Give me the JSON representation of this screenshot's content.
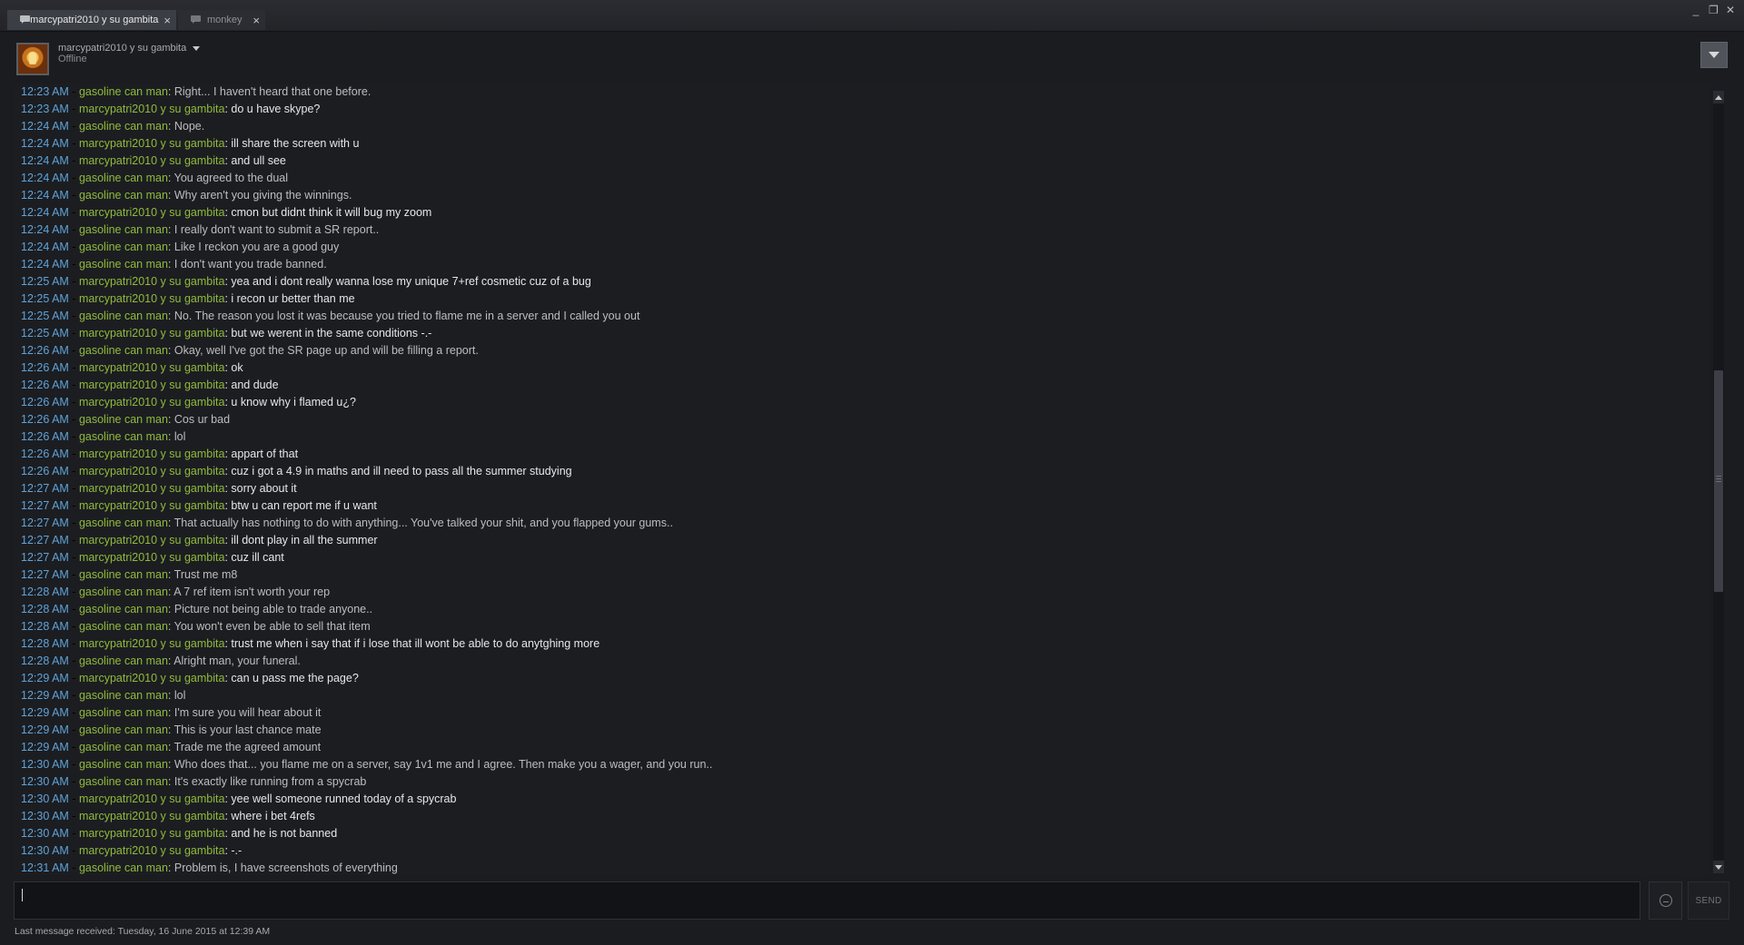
{
  "tabs": [
    {
      "label": "marcypatri2010 y su gambita",
      "close": "×",
      "active": true
    },
    {
      "label": "monkey",
      "close": "×",
      "active": false
    }
  ],
  "window_controls": {
    "minimize": "_",
    "restore": "❐",
    "close": "✕"
  },
  "header": {
    "friend_name": "marcypatri2010 y su gambita",
    "status": "Offline"
  },
  "colors": {
    "timestamp": "#5ea3d9",
    "name": "#90ba3c",
    "text_other": "#bdbdbd",
    "text_self": "#e7e7e7",
    "background": "#1b1c20"
  },
  "messages": [
    {
      "time": "12:23 AM",
      "sep": " - ",
      "name": "gasoline can man",
      "text": "Right... I haven't heard that one before.",
      "self": false
    },
    {
      "time": "12:23 AM",
      "sep": " - ",
      "name": "marcypatri2010 y su gambita",
      "text": "do u have skype?",
      "self": true
    },
    {
      "time": "12:24 AM",
      "sep": " - ",
      "name": "gasoline can man",
      "text": "Nope.",
      "self": false
    },
    {
      "time": "12:24 AM",
      "sep": " - ",
      "name": "marcypatri2010 y su gambita",
      "text": "ill share the screen with u",
      "self": true
    },
    {
      "time": "12:24 AM",
      "sep": " - ",
      "name": "marcypatri2010 y su gambita",
      "text": "and ull see",
      "self": true
    },
    {
      "time": "12:24 AM",
      "sep": " - ",
      "name": "gasoline can man",
      "text": "You agreed to the dual",
      "self": false
    },
    {
      "time": "12:24 AM",
      "sep": " - ",
      "name": "gasoline can man",
      "text": "Why aren't you giving the winnings.",
      "self": false
    },
    {
      "time": "12:24 AM",
      "sep": " - ",
      "name": "marcypatri2010 y su gambita",
      "text": "cmon but didnt think it will bug my zoom",
      "self": true
    },
    {
      "time": "12:24 AM",
      "sep": " - ",
      "name": "gasoline can man",
      "text": "I really don't want to submit a SR report..",
      "self": false
    },
    {
      "time": "12:24 AM",
      "sep": " - ",
      "name": "gasoline can man",
      "text": "Like I reckon you are a good guy",
      "self": false
    },
    {
      "time": "12:24 AM",
      "sep": " - ",
      "name": "gasoline can man",
      "text": "I don't want you trade banned.",
      "self": false
    },
    {
      "time": "12:25 AM",
      "sep": " - ",
      "name": "marcypatri2010 y su gambita",
      "text": "yea and i dont really wanna lose my unique 7+ref cosmetic cuz of a bug",
      "self": true
    },
    {
      "time": "12:25 AM",
      "sep": " - ",
      "name": "marcypatri2010 y su gambita",
      "text": "i recon ur better than me",
      "self": true
    },
    {
      "time": "12:25 AM",
      "sep": " - ",
      "name": "gasoline can man",
      "text": "No. The reason you lost it was because you tried to flame me in a server and I called you out",
      "self": false
    },
    {
      "time": "12:25 AM",
      "sep": " - ",
      "name": "marcypatri2010 y su gambita",
      "text": "but we werent in the same conditions -.-",
      "self": true
    },
    {
      "time": "12:26 AM",
      "sep": " - ",
      "name": "gasoline can man",
      "text": "Okay, well I've got the SR page up and will be filling a report.",
      "self": false
    },
    {
      "time": "12:26 AM",
      "sep": " - ",
      "name": "marcypatri2010 y su gambita",
      "text": "ok",
      "self": true
    },
    {
      "time": "12:26 AM",
      "sep": " - ",
      "name": "marcypatri2010 y su gambita",
      "text": "and dude",
      "self": true
    },
    {
      "time": "12:26 AM",
      "sep": " - ",
      "name": "marcypatri2010 y su gambita",
      "text": "u know why i flamed u¿?",
      "self": true
    },
    {
      "time": "12:26 AM",
      "sep": " - ",
      "name": "gasoline can man",
      "text": "Cos ur bad",
      "self": false
    },
    {
      "time": "12:26 AM",
      "sep": " - ",
      "name": "gasoline can man",
      "text": "lol",
      "self": false
    },
    {
      "time": "12:26 AM",
      "sep": " - ",
      "name": "marcypatri2010 y su gambita",
      "text": "appart of that",
      "self": true
    },
    {
      "time": "12:26 AM",
      "sep": " - ",
      "name": "marcypatri2010 y su gambita",
      "text": "cuz i got a 4.9 in maths and ill need to pass all the summer studying",
      "self": true
    },
    {
      "time": "12:27 AM",
      "sep": " - ",
      "name": "marcypatri2010 y su gambita",
      "text": "sorry about it",
      "self": true
    },
    {
      "time": "12:27 AM",
      "sep": " - ",
      "name": "marcypatri2010 y su gambita",
      "text": "btw u can report me if u want",
      "self": true
    },
    {
      "time": "12:27 AM",
      "sep": " - ",
      "name": "gasoline can man",
      "text": "That actually has nothing to do with anything... You've talked your shit, and you flapped your gums..",
      "self": false
    },
    {
      "time": "12:27 AM",
      "sep": " - ",
      "name": "marcypatri2010 y su gambita",
      "text": "ill dont play in all the summer",
      "self": true
    },
    {
      "time": "12:27 AM",
      "sep": " - ",
      "name": "marcypatri2010 y su gambita",
      "text": "cuz ill cant",
      "self": true
    },
    {
      "time": "12:27 AM",
      "sep": " - ",
      "name": "gasoline can man",
      "text": "Trust me m8",
      "self": false
    },
    {
      "time": "12:28 AM",
      "sep": " - ",
      "name": "gasoline can man",
      "text": "A 7 ref item isn't worth your rep",
      "self": false
    },
    {
      "time": "12:28 AM",
      "sep": " - ",
      "name": "gasoline can man",
      "text": "Picture not being able to trade anyone..",
      "self": false
    },
    {
      "time": "12:28 AM",
      "sep": " - ",
      "name": "gasoline can man",
      "text": "You won't even be able to sell that item",
      "self": false
    },
    {
      "time": "12:28 AM",
      "sep": " - ",
      "name": "marcypatri2010 y su gambita",
      "text": "trust me when i say that if i lose that ill wont be able to do anytghing more",
      "self": true
    },
    {
      "time": "12:28 AM",
      "sep": " - ",
      "name": "gasoline can man",
      "text": "Alright man, your funeral.",
      "self": false
    },
    {
      "time": "12:29 AM",
      "sep": " - ",
      "name": "marcypatri2010 y su gambita",
      "text": "can u pass me the page?",
      "self": true
    },
    {
      "time": "12:29 AM",
      "sep": " - ",
      "name": "gasoline can man",
      "text": "lol",
      "self": false
    },
    {
      "time": "12:29 AM",
      "sep": " - ",
      "name": "gasoline can man",
      "text": "I'm sure you will hear about it",
      "self": false
    },
    {
      "time": "12:29 AM",
      "sep": " - ",
      "name": "gasoline can man",
      "text": "This is your last chance mate",
      "self": false
    },
    {
      "time": "12:29 AM",
      "sep": " - ",
      "name": "gasoline can man",
      "text": "Trade me the agreed amount",
      "self": false
    },
    {
      "time": "12:30 AM",
      "sep": " - ",
      "name": "gasoline can man",
      "text": "Who does that... you flame me on a server, say 1v1 me and I agree. Then make you a wager, and you run..",
      "self": false
    },
    {
      "time": "12:30 AM",
      "sep": " - ",
      "name": "gasoline can man",
      "text": "It's exactly like running from a spycrab",
      "self": false
    },
    {
      "time": "12:30 AM",
      "sep": " - ",
      "name": "marcypatri2010 y su gambita",
      "text": "yee well someone runned today of a spycrab",
      "self": true
    },
    {
      "time": "12:30 AM",
      "sep": " - ",
      "name": "marcypatri2010 y su gambita",
      "text": "where i bet 4refs",
      "self": true
    },
    {
      "time": "12:30 AM",
      "sep": " - ",
      "name": "marcypatri2010 y su gambita",
      "text": "and he is not banned",
      "self": true
    },
    {
      "time": "12:30 AM",
      "sep": " - ",
      "name": "marcypatri2010 y su gambita",
      "text": "-.-",
      "self": true
    },
    {
      "time": "12:31 AM",
      "sep": " - ",
      "name": "gasoline can man",
      "text": "Problem is, I have screenshots of everything",
      "self": false
    }
  ],
  "input": {
    "value": ""
  },
  "send_label": "SEND",
  "footer": "Last message received: Tuesday, 16 June 2015 at 12:39 AM"
}
